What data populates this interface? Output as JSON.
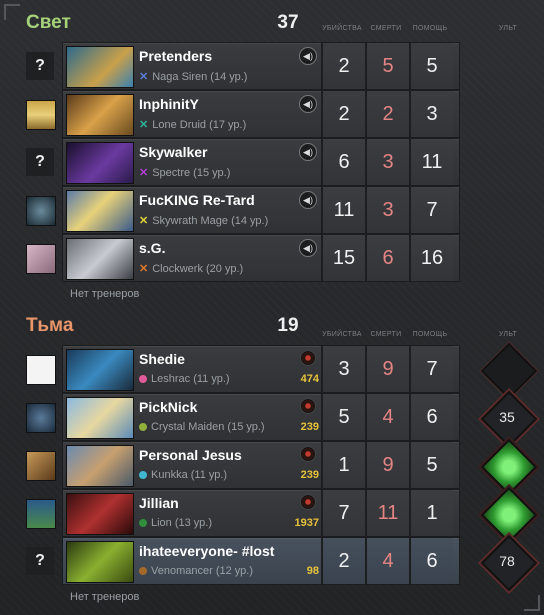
{
  "radiant": {
    "title": "Свет",
    "score": "37",
    "col_kills": "УБИЙСТВА",
    "col_deaths": "СМЕРТИ",
    "col_assists": "ПОМОЩЬ",
    "col_ult": "УЛЬТ",
    "coaches": "Нет тренеров",
    "players": [
      {
        "avatar": "?",
        "name": "Pretenders",
        "hero": "Naga Siren (14 ур.)",
        "k": "2",
        "d": "5",
        "a": "5",
        "icon_color": "#5b7bd6"
      },
      {
        "avatar": "",
        "name": "InphinitY",
        "hero": "Lone Druid (17 ур.)",
        "k": "2",
        "d": "2",
        "a": "3",
        "icon_color": "#2fb39a"
      },
      {
        "avatar": "?",
        "name": "Skywalker",
        "hero": "Spectre (15 ур.)",
        "k": "6",
        "d": "3",
        "a": "11",
        "icon_color": "#b03fd1"
      },
      {
        "avatar": "",
        "name": "FucKING Re-Tard",
        "hero": "Skywrath Mage (14 ур.)",
        "k": "11",
        "d": "3",
        "a": "7",
        "icon_color": "#e2d23a"
      },
      {
        "avatar": "",
        "name": "s.G.",
        "hero": "Clockwerk (20 ур.)",
        "k": "15",
        "d": "6",
        "a": "16",
        "icon_color": "#e07a2b"
      }
    ]
  },
  "dire": {
    "title": "Тьма",
    "score": "19",
    "col_kills": "УБИЙСТВА",
    "col_deaths": "СМЕРТИ",
    "col_assists": "ПОМОЩЬ",
    "col_ult": "УЛЬТ",
    "coaches": "Нет тренеров",
    "players": [
      {
        "avatar": "",
        "name": "Shedie",
        "hero": "Leshrac (11 ур.)",
        "gold": "474",
        "k": "3",
        "d": "9",
        "a": "7",
        "ult": "",
        "icon_color": "#e15b9b"
      },
      {
        "avatar": "",
        "name": "PickNick",
        "hero": "Crystal Maiden (15 ур.)",
        "gold": "239",
        "k": "5",
        "d": "4",
        "a": "6",
        "ult": "35",
        "icon_color": "#8fb03a"
      },
      {
        "avatar": "",
        "name": "Personal Jesus",
        "hero": "Kunkka (11 ур.)",
        "gold": "239",
        "k": "1",
        "d": "9",
        "a": "5",
        "ult": "",
        "icon_color": "#3fb7cf"
      },
      {
        "avatar": "",
        "name": "Jillian",
        "hero": "Lion (13 ур.)",
        "gold": "1937",
        "k": "7",
        "d": "11",
        "a": "1",
        "ult": "",
        "icon_color": "#2f8f3c"
      },
      {
        "avatar": "?",
        "name": "ihateeveryone-  #lost",
        "hero": "Venomancer (12 ур.)",
        "gold": "98",
        "k": "2",
        "d": "4",
        "a": "6",
        "ult": "78",
        "icon_color": "#a5692a"
      }
    ]
  }
}
